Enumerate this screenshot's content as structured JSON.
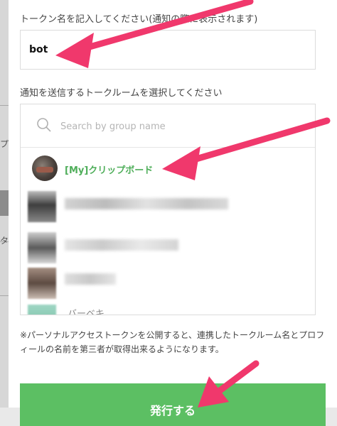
{
  "form": {
    "token_name_label": "トークン名を記入してください(通知の際に表示されます)",
    "token_name_value": "bot",
    "room_select_label": "通知を送信するトークルームを選択してください"
  },
  "room_picker": {
    "search_placeholder": "Search by group name",
    "rooms": [
      {
        "name": "[My]クリップボード"
      },
      {
        "name": "バーベキ"
      }
    ]
  },
  "notice": "※パーソナルアクセストークンを公開すると、連携したトークルーム名とプロフィールの名前を第三者が取得出来るようになります。",
  "issue_button_label": "発行する",
  "colors": {
    "accent_green": "#5cbf63",
    "room_name_green": "#4fae5a",
    "annotation_arrow": "#f0386c"
  },
  "left_sidebar": {
    "fragments": [
      "プ",
      "タ"
    ]
  }
}
